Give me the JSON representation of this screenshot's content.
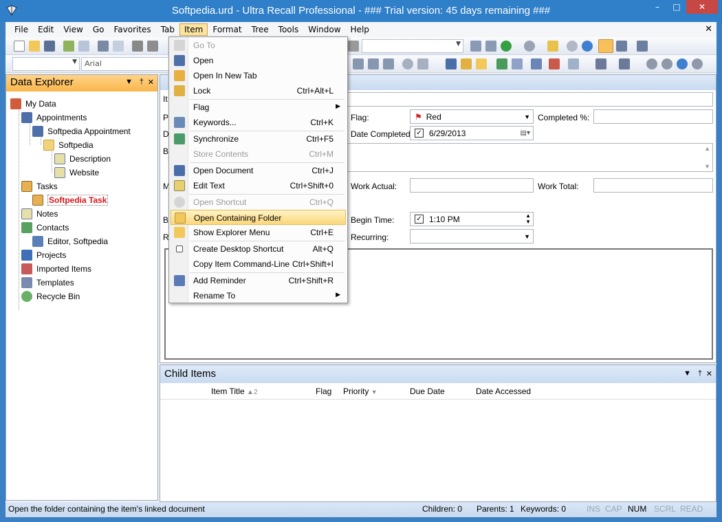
{
  "window": {
    "title": "Softpedia.urd - Ultra Recall Professional - ### Trial version: 45 days remaining ###"
  },
  "menubar": [
    "File",
    "Edit",
    "View",
    "Go",
    "Favorites",
    "Tab",
    "Item",
    "Format",
    "Tree",
    "Tools",
    "Window",
    "Help"
  ],
  "toolbar": {
    "font_name": "Arial"
  },
  "left_panel": {
    "title": "Data Explorer",
    "tree": [
      {
        "label": "My Data",
        "icon": "house-icon"
      },
      {
        "label": "Appointments",
        "icon": "calendar-icon"
      },
      {
        "label": "Softpedia Appointment",
        "icon": "calendar-icon"
      },
      {
        "label": "Softpedia",
        "icon": "folder-icon"
      },
      {
        "label": "Description",
        "icon": "note-icon"
      },
      {
        "label": "Website",
        "icon": "note-icon"
      },
      {
        "label": "Tasks",
        "icon": "task-icon"
      },
      {
        "label": "Softpedia Task",
        "icon": "task-icon"
      },
      {
        "label": "Notes",
        "icon": "note-icon"
      },
      {
        "label": "Contacts",
        "icon": "contacts-icon"
      },
      {
        "label": "Editor, Softpedia",
        "icon": "contact-icon"
      },
      {
        "label": "Projects",
        "icon": "projects-icon"
      },
      {
        "label": "Imported Items",
        "icon": "import-icon"
      },
      {
        "label": "Templates",
        "icon": "templates-icon"
      },
      {
        "label": "Recycle Bin",
        "icon": "recycle-icon"
      }
    ]
  },
  "form": {
    "partial_labels": [
      "It",
      "P",
      "D",
      "B",
      "M",
      "B",
      "R"
    ],
    "flag_label": "Flag:",
    "flag_value": "Red",
    "completed_label": "Completed %:",
    "date_completed_label": "Date Completed:",
    "date_completed_value": "6/29/2013",
    "work_actual_label": "Work Actual:",
    "work_total_label": "Work Total:",
    "begin_time_label": "Begin Time:",
    "begin_time_value": "1:10 PM",
    "recurring_label": "Recurring:"
  },
  "child_items": {
    "title": "Child Items",
    "columns": [
      "Item Title",
      "Flag",
      "Priority",
      "Due Date",
      "Date Accessed"
    ],
    "sort_indicator": "2"
  },
  "menu": {
    "items": [
      {
        "label": "Go To",
        "shortcut": "",
        "disabled": true
      },
      {
        "label": "Open",
        "shortcut": ""
      },
      {
        "label": "Open In New Tab",
        "shortcut": ""
      },
      {
        "label": "Lock",
        "shortcut": "Ctrl+Alt+L"
      },
      {
        "label": "Flag",
        "shortcut": "",
        "submenu": true
      },
      {
        "label": "Keywords...",
        "shortcut": "Ctrl+K"
      },
      {
        "label": "Synchronize",
        "shortcut": "Ctrl+F5"
      },
      {
        "label": "Store Contents",
        "shortcut": "Ctrl+M",
        "disabled": true
      },
      {
        "label": "Open Document",
        "shortcut": "Ctrl+J"
      },
      {
        "label": "Edit Text",
        "shortcut": "Ctrl+Shift+0"
      },
      {
        "label": "Open Shortcut",
        "shortcut": "Ctrl+Q",
        "disabled": true
      },
      {
        "label": "Open Containing Folder",
        "shortcut": "",
        "highlighted": true
      },
      {
        "label": "Show Explorer Menu",
        "shortcut": "Ctrl+E"
      },
      {
        "label": "Create Desktop Shortcut",
        "shortcut": "Alt+Q"
      },
      {
        "label": "Copy Item Command-Line",
        "shortcut": "Ctrl+Shift+I"
      },
      {
        "label": "Add Reminder",
        "shortcut": "Ctrl+Shift+R"
      },
      {
        "label": "Rename To",
        "shortcut": "",
        "submenu": true
      }
    ]
  },
  "statusbar": {
    "message": "Open the folder containing the item's linked document",
    "children": "Children: 0",
    "parents": "Parents: 1",
    "keywords": "Keywords: 0",
    "ins": "INS",
    "cap": "CAP",
    "num": "NUM",
    "scrl": "SCRL",
    "read": "READ"
  },
  "colors": {
    "titlebar": "#2f7fc9",
    "accent_orange": "#f9b64a",
    "selected_red": "#d8161c",
    "menu_highlight": "#fbd77a"
  }
}
